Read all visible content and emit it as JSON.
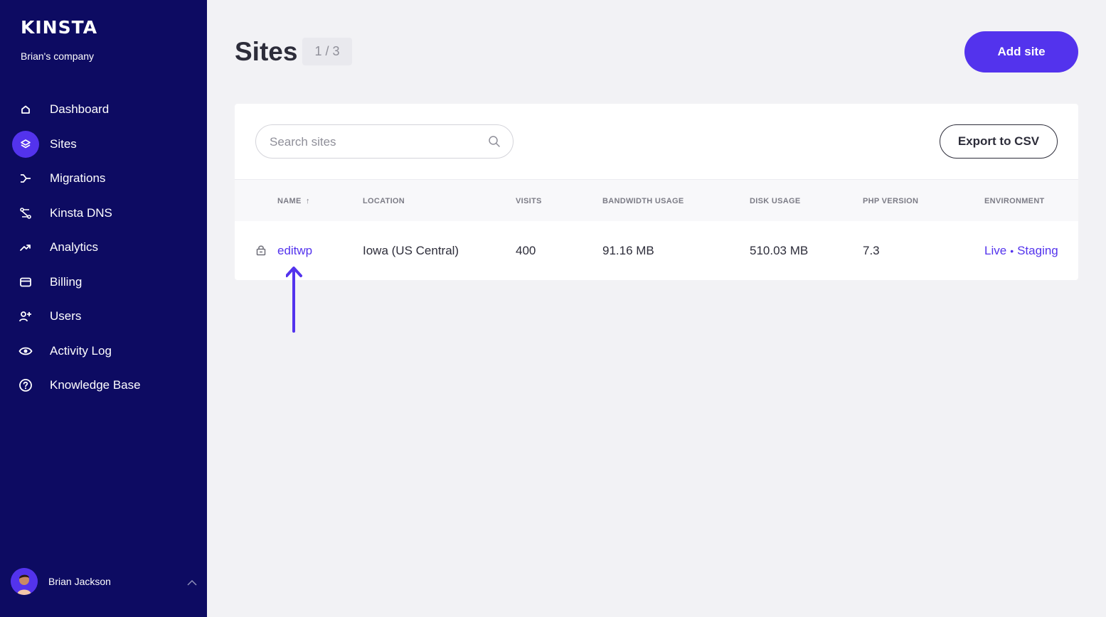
{
  "sidebar": {
    "logo": "KINSTA",
    "company": "Brian's company",
    "items": [
      {
        "label": "Dashboard",
        "icon": "home-icon",
        "active": false
      },
      {
        "label": "Sites",
        "icon": "layers-icon",
        "active": true
      },
      {
        "label": "Migrations",
        "icon": "migrations-icon",
        "active": false
      },
      {
        "label": "Kinsta DNS",
        "icon": "dns-icon",
        "active": false
      },
      {
        "label": "Analytics",
        "icon": "trend-icon",
        "active": false
      },
      {
        "label": "Billing",
        "icon": "card-icon",
        "active": false
      },
      {
        "label": "Users",
        "icon": "user-plus-icon",
        "active": false
      },
      {
        "label": "Activity Log",
        "icon": "eye-icon",
        "active": false
      },
      {
        "label": "Knowledge Base",
        "icon": "help-icon",
        "active": false
      }
    ],
    "user": {
      "name": "Brian Jackson"
    }
  },
  "header": {
    "title": "Sites",
    "count": "1 / 3",
    "add_label": "Add site"
  },
  "toolbar": {
    "search_placeholder": "Search sites",
    "export_label": "Export to CSV"
  },
  "table": {
    "columns": [
      "NAME",
      "LOCATION",
      "VISITS",
      "BANDWIDTH USAGE",
      "DISK USAGE",
      "PHP VERSION",
      "ENVIRONMENT"
    ],
    "sort_indicator": "↑",
    "rows": [
      {
        "name": "editwp",
        "location": "Iowa (US Central)",
        "visits": "400",
        "bandwidth": "91.16 MB",
        "disk": "510.03 MB",
        "php": "7.3",
        "env_live": "Live",
        "env_separator": "•",
        "env_staging": "Staging"
      }
    ]
  },
  "colors": {
    "sidebar_bg": "#0d0b62",
    "accent": "#5333ed",
    "page_bg": "#f2f2f5"
  }
}
